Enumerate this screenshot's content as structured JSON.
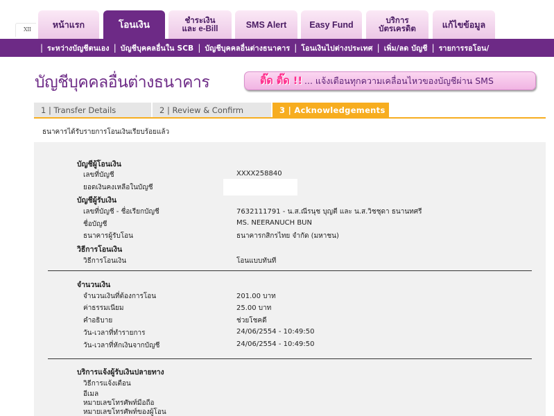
{
  "header": {
    "corner_mark": "XII",
    "tabs": [
      {
        "label": "หน้าแรก",
        "label2": ""
      },
      {
        "label": "โอนเงิน",
        "label2": ""
      },
      {
        "label": "ชำระเงิน",
        "label2": "และ e-Bill"
      },
      {
        "label": "SMS Alert",
        "label2": ""
      },
      {
        "label": "Easy Fund",
        "label2": ""
      },
      {
        "label": "บริการ",
        "label2": "บัตรเครดิต"
      },
      {
        "label": "แก้ไขข้อมูล",
        "label2": ""
      }
    ]
  },
  "subnav": {
    "items": [
      "ระหว่างบัญชีตนเอง",
      "บัญชีบุคคลอื่นใน SCB",
      "บัญชีบุคคลอื่นต่างธนาคาร",
      "โอนเงินไปต่างประเทศ",
      "เพิ่ม/ลด บัญชี",
      "รายการรอโอน/"
    ]
  },
  "page": {
    "title": "บัญชีบุคคลอื่นต่างธนาคาร",
    "banner_highlight": "ติ๊ด ติ๊ด !!",
    "banner_text": "... แจ้งเตือนทุกความเคลื่อนไหวของบัญชีผ่าน SMS"
  },
  "steps": [
    "1 | Transfer Details",
    "2 | Review & Confirm",
    "3 | Acknowledgements"
  ],
  "status_message": "ธนาคารได้รับรายการโอนเงินเรียบร้อยแล้ว",
  "details": {
    "from_header": "บัญชีผู้โอนเงิน",
    "account_no_label": "เลขที่บัญชี",
    "account_no_value": "XXXX258840",
    "balance_label": "ยอดเงินคงเหลือในบัญชี",
    "to_header": "บัญชีผู้รับเงิน",
    "to_account_label": "เลขที่บัญชี - ชื่อเรียกบัญชี",
    "to_account_value": "7632111791 - น.ส.ณีรนุช บุญตี และ น.ส.วิชชุดา ธนานทศรี",
    "to_name_label": "ชื่อบัญชี",
    "to_name_value": "MS. NEERANUCH BUN",
    "to_bank_label": "ธนาคารผู้รับโอน",
    "to_bank_value": "ธนาคารกสิกรไทย จำกัด (มหาชน)",
    "method_header": "วิธีการโอนเงิน",
    "method_label": "วิธีการโอนเงิน",
    "method_value": "โอนแบบทันที",
    "amount_header": "จำนวนเงิน",
    "amount_label": "จำนวนเงินที่ต้องการโอน",
    "amount_value": "201.00 บาท",
    "fee_label": "ค่าธรรมเนียม",
    "fee_value": "25.00 บาท",
    "desc_label": "คำอธิบาย",
    "desc_value": "ช่วยโชคดี",
    "txn_time_label": "วัน-เวลาที่ทำรายการ",
    "txn_time_value": "24/06/2554 - 10:49:50",
    "debit_time_label": "วัน-เวลาที่หักเงินจากบัญชี",
    "debit_time_value": "24/06/2554 - 10:49:50",
    "notify_header": "บริการแจ้งผู้รับเงินปลายทาง",
    "notify_method_label": "วิธีการแจ้งเตือน",
    "email_label": "อีเมล",
    "mobile_label": "หมายเลขโทรศัพท์มือถือ",
    "sender_phone_label": "หมายเลขโทรศัพท์ของผู้โอน"
  },
  "colors": {
    "brand_purple": "#6d2a86",
    "step_active": "#f7ad1f",
    "banner_pink": "#ff2a8a"
  }
}
